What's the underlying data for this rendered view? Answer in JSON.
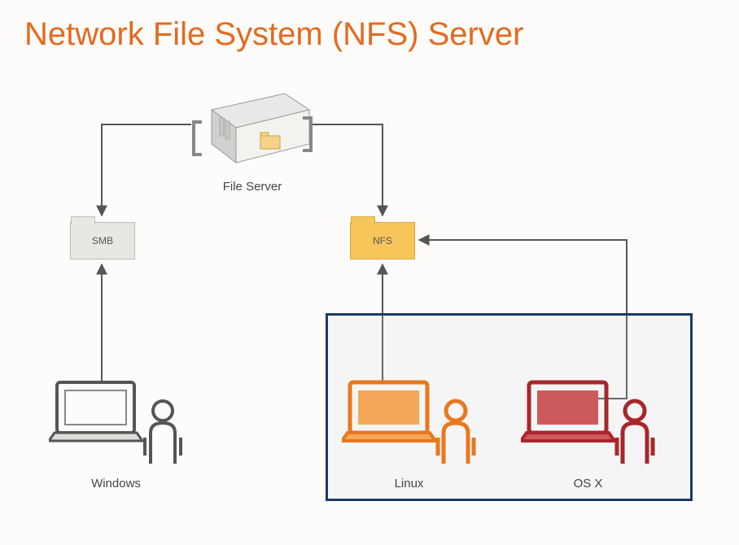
{
  "title": "Network File System (NFS) Server",
  "nodes": {
    "server": {
      "label": "File Server"
    },
    "smb": {
      "label": "SMB"
    },
    "nfs": {
      "label": "NFS"
    },
    "windows": {
      "label": "Windows"
    },
    "linux": {
      "label": "Linux"
    },
    "osx": {
      "label": "OS X"
    }
  }
}
